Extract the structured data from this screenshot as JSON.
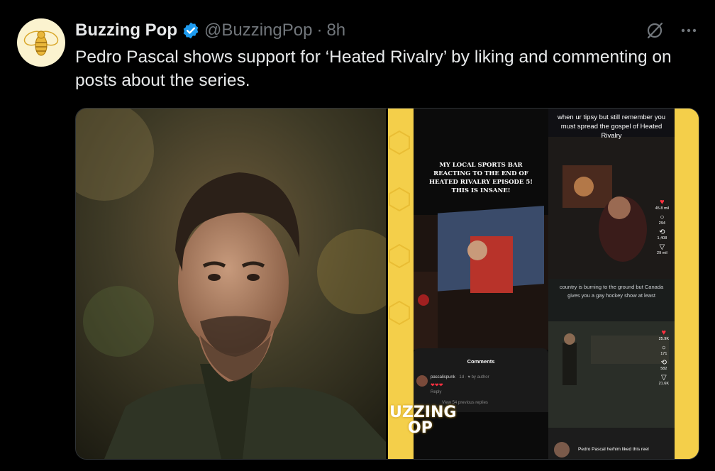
{
  "tweet": {
    "author_name": "Buzzing Pop",
    "handle": "@BuzzingPop",
    "separator": "·",
    "time": "8h",
    "text": "Pedro Pascal shows support for ‘Heated Rivalry’ by liking and commenting on posts about the series."
  },
  "actions": {
    "grok_icon": "grok-slash-icon",
    "more_icon": "more-dots-icon"
  },
  "media": {
    "left_image": "man-with-dark-hair-and-mustache-photo",
    "right_collage": {
      "post1_caption": "MY LOCAL SPORTS BAR REACTING TO THE END OF HEATED RIVALRY EPISODE 5! THIS IS INSANE!",
      "post1_comments_title": "Comments",
      "post1_comment_user": "pascalispunk",
      "post1_comment_meta": "1d · ♥ by author",
      "post1_comment_hearts": "❤❤❤",
      "post1_comment_reply": "Reply",
      "post1_view_replies": "View 54 previous replies",
      "post2_caption": "when ur tipsy but still remember you must spread the gospel of Heated Rivalry",
      "post2_likes": "45.8 mil",
      "post2_comments": "294",
      "post2_reposts": "1,408",
      "post2_shares": "29 mil",
      "post3_caption": "country is burning to the ground but Canada gives you a gay hockey show at least",
      "post3_likes": "25.9K",
      "post3_comments": "171",
      "post3_reposts": "582",
      "post3_shares": "21.6K",
      "liked_by": "Pedro Pascal he/him liked this reel",
      "logo_text_top": "UZZING",
      "logo_text_bottom": "OP"
    }
  },
  "colors": {
    "background": "#000000",
    "text": "#e7e9ea",
    "secondary": "#71767b",
    "verified": "#1d9bf0",
    "brand_yellow": "#f4cf4a"
  }
}
